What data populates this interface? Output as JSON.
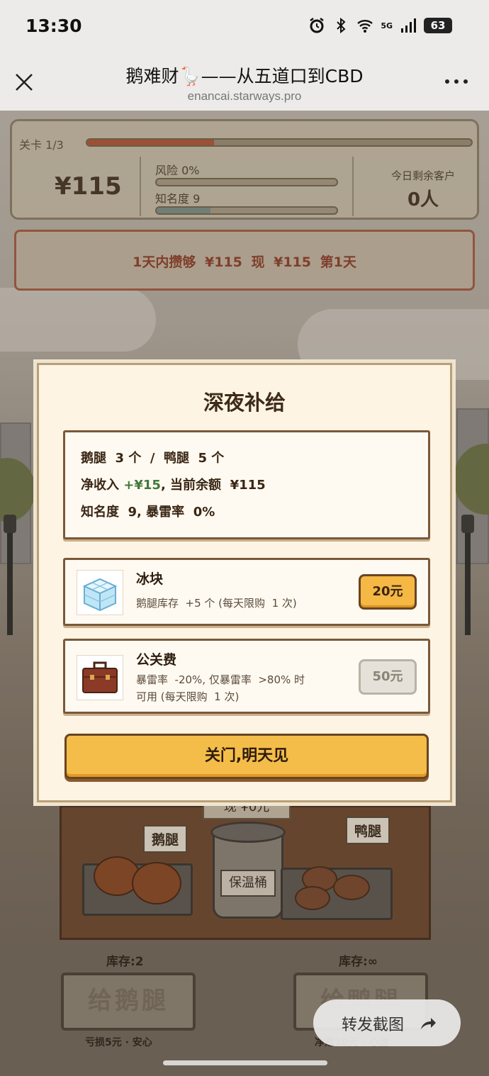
{
  "status_bar": {
    "time": "13:30",
    "network": "5G",
    "battery": "63"
  },
  "browser": {
    "title": "鹅难财🪿——从五道口到CBD",
    "url": "enancai.starways.pro"
  },
  "hud": {
    "level_label": "关卡 1/3",
    "level_progress": 0.33,
    "money": "¥115",
    "risk_label": "风险  0%",
    "risk_progress": 0,
    "fame_label": "知名度  9",
    "fame_progress": 0.3,
    "customers_label": "今日剩余客户",
    "customers_value": "0人"
  },
  "goal": {
    "text": "1天内攒够 ¥115  现 ¥115  第1天"
  },
  "stall": {
    "goose_tag": "鹅腿",
    "duck_tag": "鸭腿",
    "bucket_label": "保温桶",
    "sign_partial": "现 ¥0元",
    "goose_stock": "库存:2",
    "duck_stock": "库存:∞",
    "give_goose": "给鹅腿",
    "give_duck": "给鸭腿",
    "goose_sub": "亏损5元 · 安心",
    "duck_sub": "净赚10元 · 心虚"
  },
  "modal": {
    "title": "深夜补给",
    "summary": {
      "line1": "鹅腿  3 个  /  鸭腿  5 个",
      "line2_prefix": "净收入 ",
      "line2_income": "+¥15",
      "line2_suffix": ", 当前余额  ¥115",
      "line3": "知名度  9, 暴雷率  0%"
    },
    "items": [
      {
        "name": "冰块",
        "desc_line1": "鹅腿库存  +5 个 (每天限购  1 次)",
        "desc_line2": "",
        "price": "20元",
        "enabled": true,
        "icon": "ice-cube-icon"
      },
      {
        "name": "公关费",
        "desc_line1": "暴雷率  -20%, 仅暴雷率  >80% 时",
        "desc_line2": "可用 (每天限购  1 次)",
        "price": "50元",
        "enabled": false,
        "icon": "briefcase-icon"
      }
    ],
    "close_button": "关门,明天见"
  },
  "share": {
    "label": "转发截图",
    "icon": "forward-arrow-icon"
  },
  "colors": {
    "accent": "#f4bd4a",
    "income_green": "#3f7a3a",
    "goal_red": "#8a3a22"
  }
}
